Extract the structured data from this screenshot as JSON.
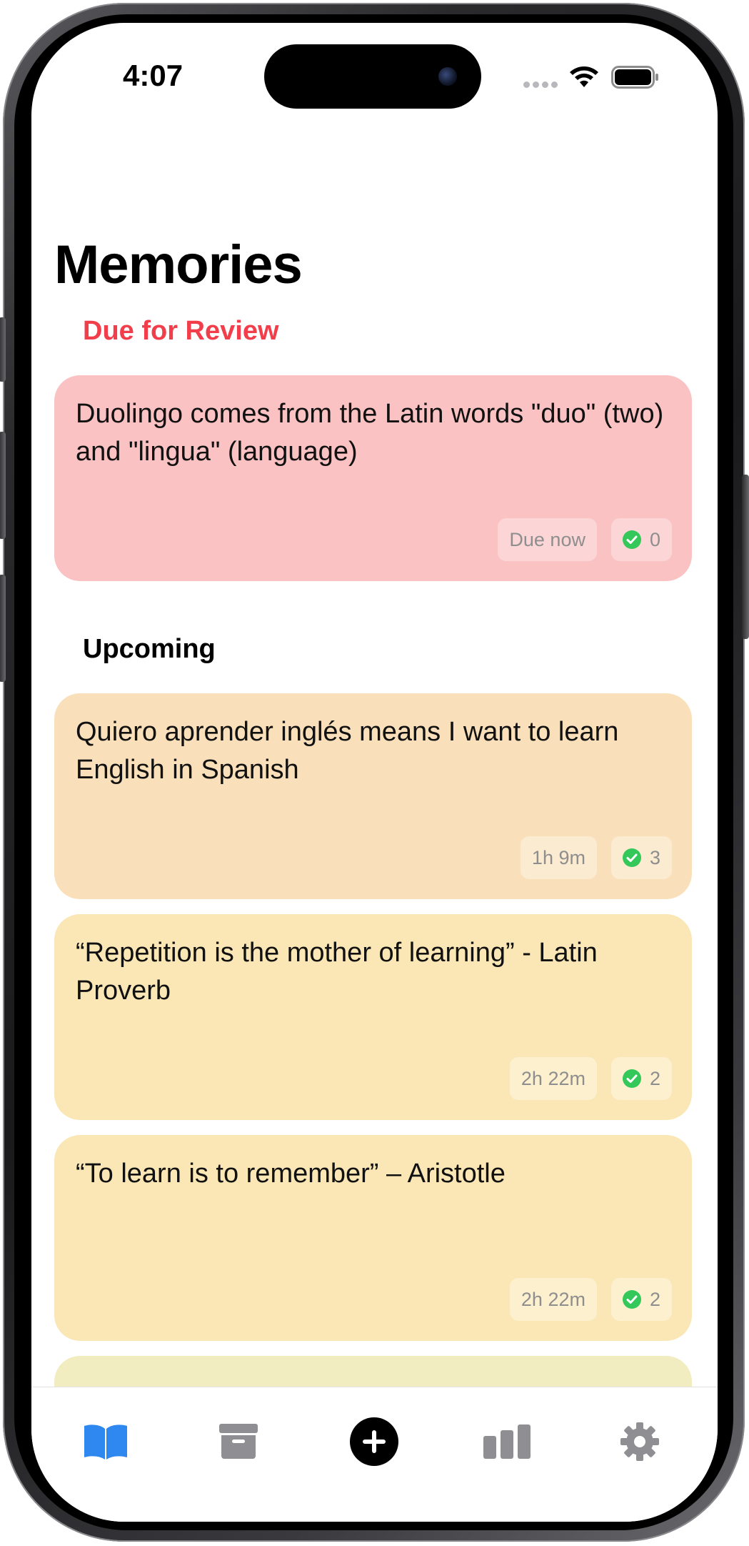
{
  "status_bar": {
    "time": "4:07"
  },
  "page": {
    "title": "Memories"
  },
  "sections": {
    "due": {
      "label": "Due for Review",
      "color": "#f23d4a"
    },
    "upcoming": {
      "label": "Upcoming"
    }
  },
  "cards": [
    {
      "text": "Duolingo comes from the Latin words \"duo\" (two) and \"lingua\" (language)",
      "due": "Due now",
      "reviews": "0",
      "background": "#fac2c3",
      "pill_background": "#fcd6d6"
    },
    {
      "text": "Quiero aprender inglés means I want to learn English in Spanish",
      "due": "1h 9m",
      "reviews": "3",
      "background": "#f9e0ba",
      "pill_background": "#fbebd1"
    },
    {
      "text": "“Repetition is the mother of learning” - Latin Proverb",
      "due": "2h 22m",
      "reviews": "2",
      "background": "#fae7b5",
      "pill_background": "#fcf0cf"
    },
    {
      "text": "“To learn is to remember” – Aristotle",
      "due": "2h 22m",
      "reviews": "2",
      "background": "#fae7b5",
      "pill_background": "#fcf0cf"
    },
    {
      "text": "",
      "background": "#f2edc0"
    }
  ],
  "tab_bar": {
    "items": [
      {
        "icon": "book-icon",
        "active": true,
        "color": "#2f87f0"
      },
      {
        "icon": "archive-icon",
        "active": false,
        "color": "#8e8e93"
      },
      {
        "icon": "plus-circle-icon",
        "active": false,
        "color": "#000000"
      },
      {
        "icon": "bar-chart-icon",
        "active": false,
        "color": "#8e8e93"
      },
      {
        "icon": "gear-icon",
        "active": false,
        "color": "#8e8e93"
      }
    ]
  },
  "colors": {
    "accent": "#2f87f0",
    "check": "#34c759"
  }
}
